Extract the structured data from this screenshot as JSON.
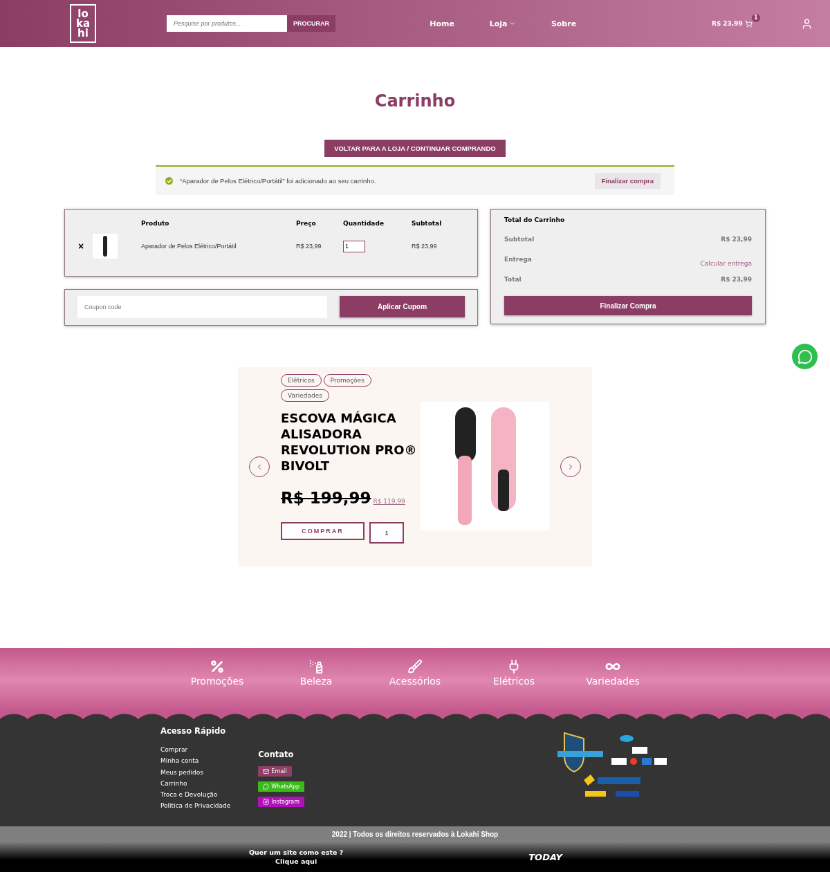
{
  "header": {
    "logo": [
      "lo",
      "ka",
      "hi"
    ],
    "search": {
      "placeholder": "Pesquise por produtos...",
      "button": "PROCURAR"
    },
    "nav": [
      {
        "label": "Home",
        "dropdown": false
      },
      {
        "label": "Loja",
        "dropdown": true
      },
      {
        "label": "Sobre",
        "dropdown": false
      }
    ],
    "cart": {
      "total": "R$ 23,99",
      "count": "1"
    }
  },
  "page_title": "Carrinho",
  "back_button": "VOLTAR PARA A LOJA / CONTINUAR COMPRANDO",
  "notice": {
    "message": "“Aparador de Pelos Elétrico/Portátil” foi adicionado ao seu carrinho.",
    "button": "Finalizar compra"
  },
  "cart_table": {
    "columns": [
      "Produto",
      "Preço",
      "Quantidade",
      "Subtotal"
    ],
    "rows": [
      {
        "remove": "×",
        "product": "Aparador de Pelos Elétrico/Portátil",
        "price": "R$ 23,99",
        "quantity": "1",
        "subtotal": "R$ 23,99"
      }
    ]
  },
  "coupon": {
    "placeholder": "Coupon code",
    "button": "Aplicar Cupom"
  },
  "totals": {
    "title": "Total do Carrinho",
    "rows": [
      {
        "label": "Subtotal",
        "value": "R$ 23,99",
        "kind": "amount"
      },
      {
        "label": "Entrega",
        "value": "Calcular entrega",
        "kind": "link"
      },
      {
        "label": "Total",
        "value": "R$ 23,99",
        "kind": "amount"
      }
    ],
    "button": "Finalizar Compra"
  },
  "featured": {
    "tags": [
      "Elétricos",
      "Promoções",
      "Variedades"
    ],
    "title": "ESCOVA MÁGICA ALISADORA REVOLUTION PRO® BIVOLT",
    "old_price": "R$ 199,99",
    "price": "R$ 119,99",
    "buy": "COMPRAR",
    "quantity": "1"
  },
  "categories": [
    {
      "label": "Promoções"
    },
    {
      "label": "Beleza"
    },
    {
      "label": "Acessórios"
    },
    {
      "label": "Elétricos"
    },
    {
      "label": "Variedades"
    }
  ],
  "footer": {
    "quick_title": "Acesso Rápido",
    "quick_links": [
      "Comprar",
      "Minha conta",
      "Meus pedidos",
      "Carrinho",
      "Troca e Devolução",
      "Politica de Privacidade"
    ],
    "contact_title": "Contato",
    "contacts": [
      {
        "label": "Email",
        "color": "#8e3f66"
      },
      {
        "label": "WhatsApp",
        "color": "#3dba1b"
      },
      {
        "label": "Instagram",
        "color": "#b012b8"
      }
    ],
    "copyright": "2022 | Todos os direitos reservados à Lokahi Shop",
    "cta": [
      "Quer um site como este ?",
      "Clique aqui"
    ],
    "credit_logo": "TODAY"
  }
}
